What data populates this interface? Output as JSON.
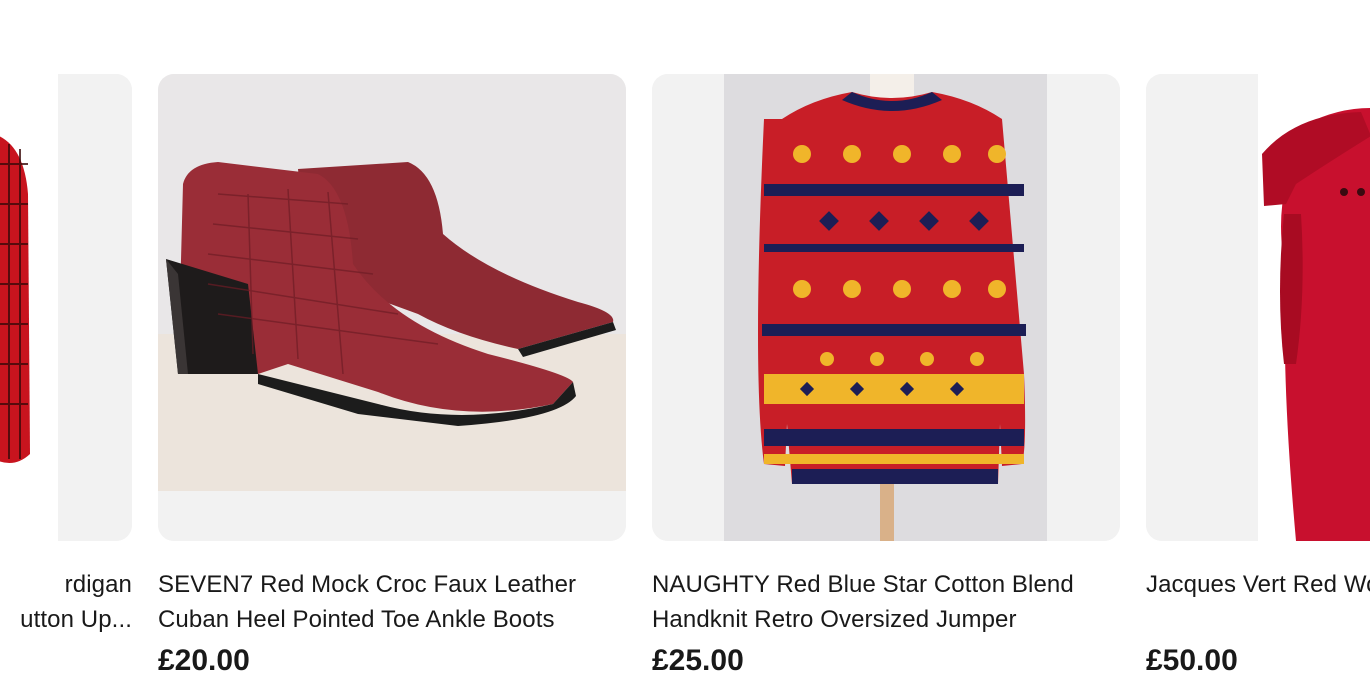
{
  "products": [
    {
      "title_line1": "rdigan",
      "title_line2": "utton Up...",
      "price": ""
    },
    {
      "title": "SEVEN7 Red Mock Croc Faux Leather Cuban Heel Pointed Toe Ankle Boots",
      "price": "£20.00"
    },
    {
      "title": "NAUGHTY Red Blue Star Cotton Blend Handknit Retro Oversized Jumper",
      "price": "£25.00"
    },
    {
      "title": "Jacques Vert Red Wool Long Lovely",
      "price": "£50.00"
    }
  ],
  "icons": [
    "cardigan-image",
    "boots-image",
    "jumper-image",
    "coat-image"
  ],
  "colors": {
    "card_bg": "#f2f2f2",
    "text": "#191919"
  }
}
